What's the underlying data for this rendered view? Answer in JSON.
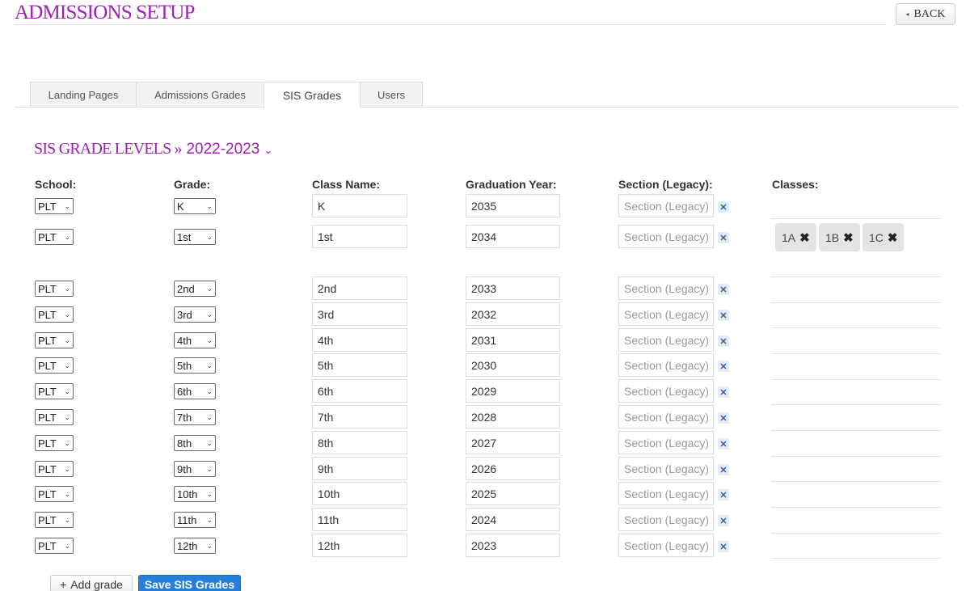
{
  "header": {
    "title": "ADMISSIONS SETUP",
    "back_label": "BACK",
    "back_icon": "◂"
  },
  "tabs": [
    {
      "label": "Landing Pages"
    },
    {
      "label": "Admissions Grades"
    },
    {
      "label": "SIS Grades"
    },
    {
      "label": "Users"
    }
  ],
  "section": {
    "title": "SIS GRADE LEVELS",
    "separator": "»",
    "year": "2022-2023",
    "chevron": "⌄"
  },
  "columns": {
    "school": "School:",
    "grade": "Grade:",
    "class_name": "Class Name:",
    "graduation_year": "Graduation Year:",
    "section_legacy": "Section (Legacy):",
    "classes": "Classes:"
  },
  "rows": [
    {
      "school": "PLT",
      "grade": "K",
      "class_name": "K",
      "graduation_year": "2035",
      "section_placeholder": "Section (Legacy)"
    },
    {
      "school": "PLT",
      "grade": "1st",
      "class_name": "1st",
      "graduation_year": "2034",
      "section_placeholder": "Section (Legacy)"
    },
    {
      "school": "PLT",
      "grade": "2nd",
      "class_name": "2nd",
      "graduation_year": "2033",
      "section_placeholder": "Section (Legacy)"
    },
    {
      "school": "PLT",
      "grade": "3rd",
      "class_name": "3rd",
      "graduation_year": "2032",
      "section_placeholder": "Section (Legacy)"
    },
    {
      "school": "PLT",
      "grade": "4th",
      "class_name": "4th",
      "graduation_year": "2031",
      "section_placeholder": "Section (Legacy)"
    },
    {
      "school": "PLT",
      "grade": "5th",
      "class_name": "5th",
      "graduation_year": "2030",
      "section_placeholder": "Section (Legacy)"
    },
    {
      "school": "PLT",
      "grade": "6th",
      "class_name": "6th",
      "graduation_year": "2029",
      "section_placeholder": "Section (Legacy)"
    },
    {
      "school": "PLT",
      "grade": "7th",
      "class_name": "7th",
      "graduation_year": "2028",
      "section_placeholder": "Section (Legacy)"
    },
    {
      "school": "PLT",
      "grade": "8th",
      "class_name": "8th",
      "graduation_year": "2027",
      "section_placeholder": "Section (Legacy)"
    },
    {
      "school": "PLT",
      "grade": "9th",
      "class_name": "9th",
      "graduation_year": "2026",
      "section_placeholder": "Section (Legacy)"
    },
    {
      "school": "PLT",
      "grade": "10th",
      "class_name": "10th",
      "graduation_year": "2025",
      "section_placeholder": "Section (Legacy)"
    },
    {
      "school": "PLT",
      "grade": "11th",
      "class_name": "11th",
      "graduation_year": "2024",
      "section_placeholder": "Section (Legacy)"
    },
    {
      "school": "PLT",
      "grade": "12th",
      "class_name": "12th",
      "graduation_year": "2023",
      "section_placeholder": "Section (Legacy)"
    }
  ],
  "classes_chips": [
    {
      "label": "1A",
      "remove_icon": "✖"
    },
    {
      "label": "1B",
      "remove_icon": "✖"
    },
    {
      "label": "1C",
      "remove_icon": "✖"
    }
  ],
  "icons": {
    "select_arrow": "⌄",
    "remove_section": "✕"
  },
  "actions": {
    "add_label": "Add grade",
    "add_icon": "+",
    "save_label": "Save SIS Grades"
  },
  "colors": {
    "accent": "#a020b5",
    "primary_button": "#2680d9",
    "remove_icon": "#2a5fb0"
  }
}
